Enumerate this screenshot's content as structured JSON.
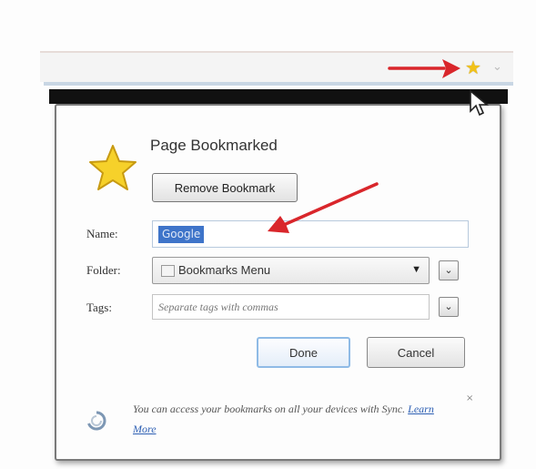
{
  "panel": {
    "title": "Page Bookmarked",
    "remove_button": "Remove Bookmark",
    "name_label": "Name:",
    "name_value": "Google",
    "folder_label": "Folder:",
    "folder_value": "Bookmarks Menu",
    "tags_label": "Tags:",
    "tags_placeholder": "Separate tags with commas",
    "done_button": "Done",
    "cancel_button": "Cancel",
    "sync_text": "You can access your bookmarks on all your devices with Sync.",
    "learn_more": "Learn More",
    "close_symbol": "×"
  },
  "icons": {
    "toolbar_star": "star-icon",
    "big_star": "star-icon",
    "sync": "sync-icon",
    "dropdown": "chevron-down-icon"
  },
  "colors": {
    "arrow": "#d9262b",
    "star": "#f2c218",
    "selection": "#3e74c9",
    "link": "#2d5fb3"
  }
}
